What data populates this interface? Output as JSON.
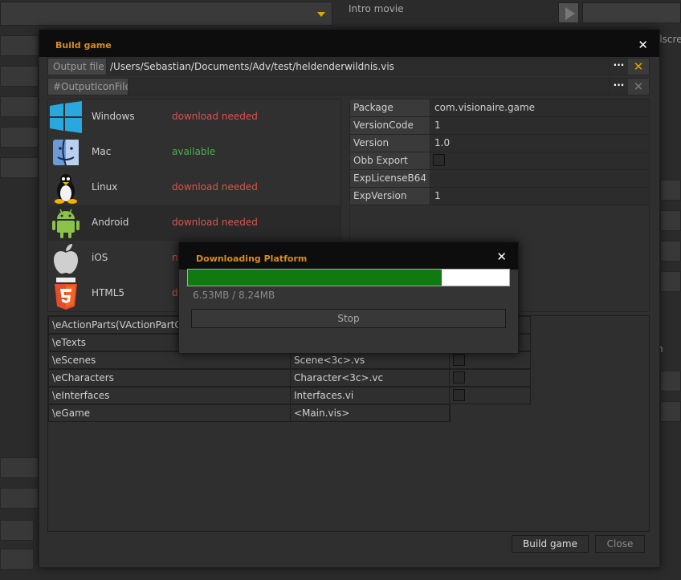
{
  "background": {
    "intro_label": "Intro movie",
    "right_cut_1": "llscre",
    "right_cut_2": "n"
  },
  "dialog": {
    "title": "Build game",
    "close_glyph": "✕",
    "output_file": {
      "label": "Output file",
      "value": "/Users/Sebastian/Documents/Adv/test/heldenderwildnis.vis",
      "browse": "···",
      "clear": "✕",
      "clear_color": "#e5a100"
    },
    "output_icon": {
      "label": "#OutputIconFile",
      "value": "",
      "browse": "···",
      "clear": "✕",
      "clear_color": "#777777"
    },
    "platforms": [
      {
        "name": "Windows",
        "status": "download needed",
        "status_color": "#d9534f",
        "icon": "windows-icon"
      },
      {
        "name": "Mac",
        "status": "available",
        "status_color": "#4caf50",
        "icon": "mac-finder-icon"
      },
      {
        "name": "Linux",
        "status": "download needed",
        "status_color": "#d9534f",
        "icon": "linux-tux-icon"
      },
      {
        "name": "Android",
        "status": "download needed",
        "status_color": "#d9534f",
        "icon": "android-icon"
      },
      {
        "name": "iOS",
        "status": "no",
        "status_color": "#d9534f",
        "icon": "apple-icon"
      },
      {
        "name": "HTML5",
        "status": "do",
        "status_color": "#d9534f",
        "icon": "html5-icon"
      }
    ],
    "properties": [
      {
        "key": "Package",
        "value": "com.visionaire.game"
      },
      {
        "key": "VersionCode",
        "value": "1"
      },
      {
        "key": "Version",
        "value": "1.0"
      },
      {
        "key": "Obb Export",
        "value": "",
        "checkbox": true
      },
      {
        "key": "ExpLicenseB64",
        "value": ""
      },
      {
        "key": "ExpVersion",
        "value": "1"
      }
    ],
    "parts": [
      {
        "name": "\\eActionParts(VActionPartCo",
        "file": ""
      },
      {
        "name": "\\eTexts",
        "file": ""
      },
      {
        "name": "\\eScenes",
        "file": "Scene<3c>.vs"
      },
      {
        "name": "\\eCharacters",
        "file": "Character<3c>.vc"
      },
      {
        "name": "\\eInterfaces",
        "file": "Interfaces.vi"
      },
      {
        "name": "\\eGame",
        "file": "<Main.vis>"
      }
    ],
    "build_button": "Build game",
    "close_button": "Close"
  },
  "download": {
    "title": "Downloading Platform",
    "close_glyph": "✕",
    "progress": 0.79,
    "size_text": "6.53MB / 8.24MB",
    "stop_label": "Stop",
    "bar_color": "#0f7a0f"
  }
}
